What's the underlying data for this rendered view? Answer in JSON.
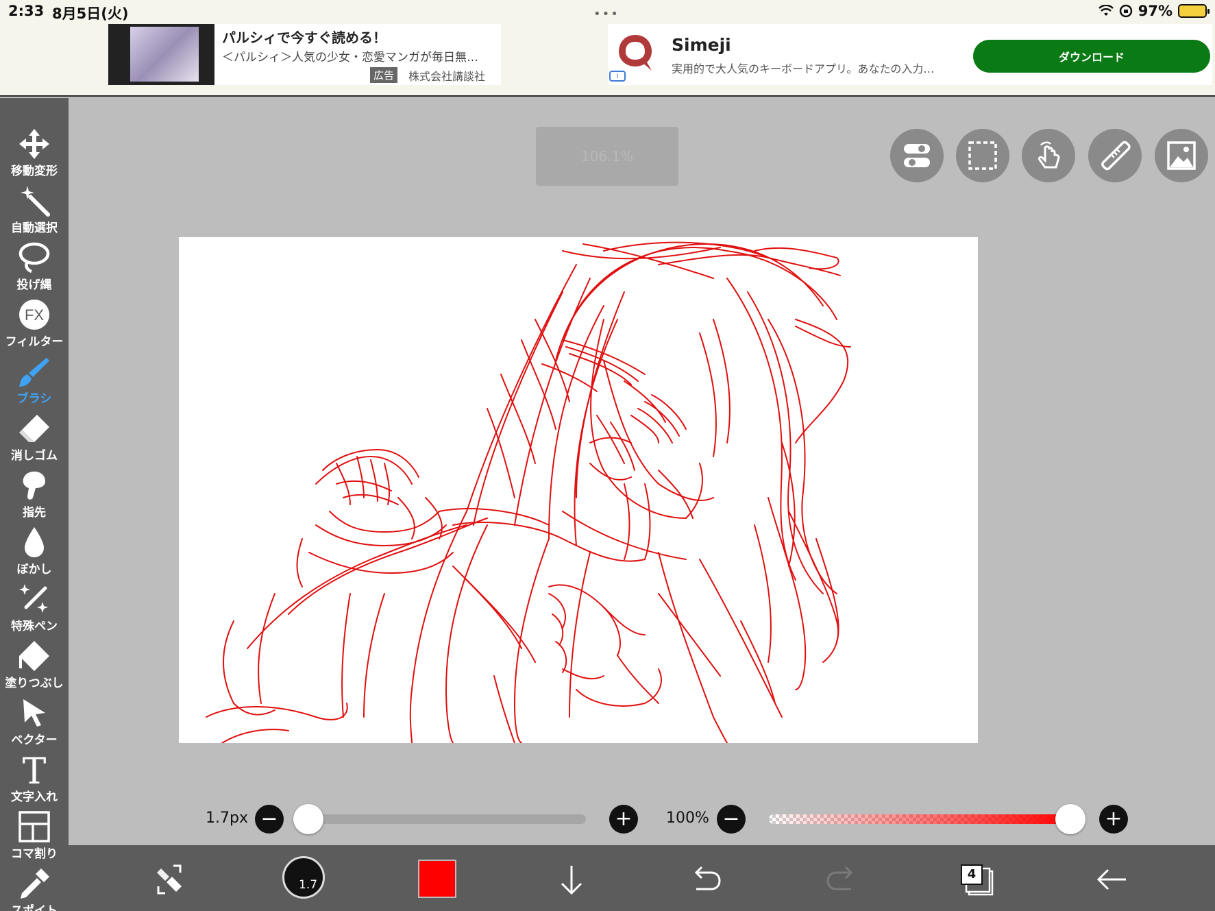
{
  "status": {
    "time": "2:33",
    "date": "8月5日(火)",
    "dots": "•••",
    "battery": "97%"
  },
  "ads": {
    "ad1": {
      "title": "パルシィで今すぐ読める！",
      "desc": "＜パルシィ＞人気の少女・恋愛マンガが毎日無…",
      "badge": "広告",
      "company": "株式会社講談社"
    },
    "ad2": {
      "title": "Simeji",
      "desc": "実用的で大人気のキーボードアプリ。あなたの入力…",
      "button": "ダウンロード",
      "info": "i",
      "brand_color": "#b03a3a"
    }
  },
  "tools": [
    {
      "label": "移動変形",
      "icon": "move-transform-icon"
    },
    {
      "label": "自動選択",
      "icon": "magic-wand-icon"
    },
    {
      "label": "投げ縄",
      "icon": "lasso-icon"
    },
    {
      "label": "フィルター",
      "icon": "fx-filter-icon",
      "text": "FX"
    },
    {
      "label": "ブラシ",
      "icon": "brush-icon",
      "active": true
    },
    {
      "label": "消しゴム",
      "icon": "eraser-icon"
    },
    {
      "label": "指先",
      "icon": "smudge-finger-icon"
    },
    {
      "label": "ぼかし",
      "icon": "blur-drop-icon"
    },
    {
      "label": "特殊ペン",
      "icon": "special-pen-icon"
    },
    {
      "label": "塗りつぶし",
      "icon": "fill-bucket-icon"
    },
    {
      "label": "ベクター",
      "icon": "vector-arrow-icon"
    },
    {
      "label": "文字入れ",
      "icon": "text-tool-icon",
      "text": "T"
    },
    {
      "label": "コマ割り",
      "icon": "panel-divide-icon"
    },
    {
      "label": "スポイト",
      "icon": "eyedropper-icon"
    }
  ],
  "canvas": {
    "zoom": "106.1%",
    "top_buttons": [
      "toggle-icon",
      "selection-rect-icon",
      "touch-gesture-icon",
      "ruler-icon",
      "image-icon"
    ],
    "stroke_color": "#e01010"
  },
  "sliders": {
    "size_label": "1.7px",
    "size_value": 0.0,
    "opacity_label": "100%",
    "opacity_value": 1.0,
    "minus": "−",
    "plus": "+"
  },
  "bottom": {
    "brush_size": "1.7",
    "color": "#ff0000",
    "layer_count": "4",
    "icons": [
      "swap-tool-icon",
      "brush-size-icon",
      "color-swatch",
      "download-arrow-icon",
      "undo-icon",
      "redo-icon",
      "layers-icon",
      "back-arrow-icon"
    ]
  },
  "colors": {
    "toolbar_bg": "#5c5c5c",
    "workspace_bg": "#bdbdbd",
    "accent": "#3fa3f5"
  }
}
